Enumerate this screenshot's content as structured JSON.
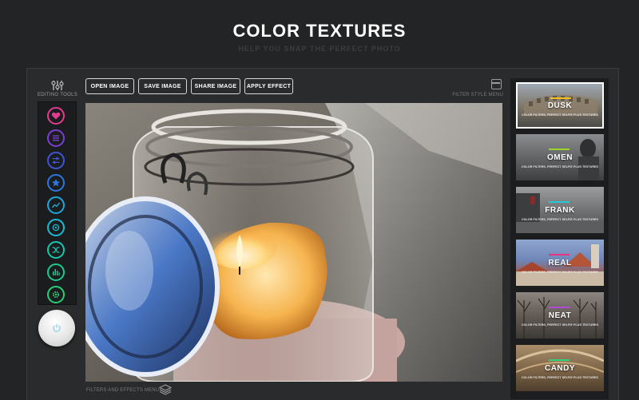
{
  "hero": {
    "title": "COLOR TEXTURES",
    "subtitle": "HELP YOU SNAP THE PERFECT PHOTO"
  },
  "tools": {
    "label": "EDITING TOOLS",
    "items": [
      {
        "name": "heart-tool",
        "color": "#e33b8f"
      },
      {
        "name": "list-tool",
        "color": "#7b3fd0"
      },
      {
        "name": "adjust-tool",
        "color": "#3f55d6"
      },
      {
        "name": "star-tool",
        "color": "#2a78e0"
      },
      {
        "name": "curve-tool",
        "color": "#1fa6d8"
      },
      {
        "name": "focus-tool",
        "color": "#19bcd6"
      },
      {
        "name": "shuffle-tool",
        "color": "#17c7b0"
      },
      {
        "name": "levels-tool",
        "color": "#1ec98e"
      },
      {
        "name": "gear-tool",
        "color": "#27cf74"
      }
    ]
  },
  "toolbar": {
    "open_label": "OPEN IMAGE",
    "save_label": "SAVE IMAGE",
    "share_label": "SHARE IMAGE",
    "apply_label": "APPLY EFFECT",
    "filter_style_menu_label": "FILTER STYLE MENU"
  },
  "footer": {
    "filters_menu_label": "FILTERS AND EFFECTS MENU"
  },
  "filters": [
    {
      "name": "DUSK",
      "desc": "COLOR FILTERS, PERFECT SELFIE PLUS TEXTURES",
      "accent": "#f2c21b",
      "selected": true
    },
    {
      "name": "OMEN",
      "desc": "COLOR FILTERS, PERFECT SELFIE PLUS TEXTURES",
      "accent": "#9ad62a",
      "selected": false
    },
    {
      "name": "FRANK",
      "desc": "COLOR FILTERS, PERFECT SELFIE PLUS TEXTURES",
      "accent": "#1fc9d8",
      "selected": false
    },
    {
      "name": "REAL",
      "desc": "COLOR FILTERS, PERFECT SELFIE PLUS TEXTURES",
      "accent": "#e8347e",
      "selected": false
    },
    {
      "name": "NEAT",
      "desc": "COLOR FILTERS, PERFECT SELFIE PLUS TEXTURES",
      "accent": "#b14bd8",
      "selected": false
    },
    {
      "name": "CANDY",
      "desc": "COLOR FILTERS, PERFECT SELFIE PLUS TEXTURES",
      "accent": "#2fd47c",
      "selected": false
    }
  ]
}
